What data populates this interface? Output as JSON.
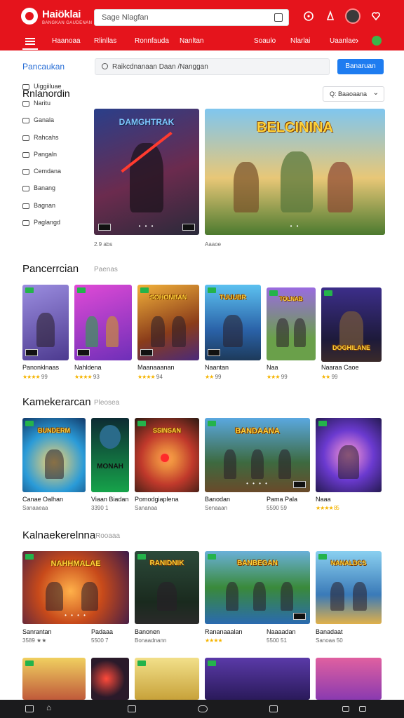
{
  "header": {
    "logo_title": "Haiöklai",
    "logo_sub": "BANGKAN GAUDENAN",
    "search_text": "Sage Nlagfan"
  },
  "nav": {
    "links": [
      "Haanoaa",
      "Rlinllas",
      "Ronnfauda",
      "Nanltan",
      "Soaulo",
      "Nlarlai",
      "Uaanlae"
    ]
  },
  "sidebar": {
    "title": "Pancaukan",
    "items": [
      "Uiggiiluae",
      "Naritu",
      "Ganala",
      "Rahcahs",
      "Pangaln",
      "Cemdana",
      "Banang",
      "Bagnan",
      "Paglangd"
    ]
  },
  "filter": {
    "search_placeholder": "Raikcdnanaan  Daan  /Nanggan",
    "search_button": "Banaruan",
    "sort_label": "Q: Baaoaana"
  },
  "featured": {
    "title": "Rnlanordin",
    "cards": [
      {
        "banner": "DAMGHTRAK",
        "label": "2.9 abs"
      },
      {
        "banner": "BELCININA",
        "label": "Aaaoe"
      }
    ]
  },
  "sections": [
    {
      "title": "Pancerrcian",
      "sub": "Paenas",
      "cards": [
        {
          "label": "Panonklnaas",
          "rating": "★★★★",
          "count": "99"
        },
        {
          "label": "Nahldena",
          "rating": "★★★★",
          "count": "93"
        },
        {
          "label": "Maanaaanan",
          "rating": "★★★★",
          "count": "94"
        },
        {
          "label": "Naantan",
          "rating": "★★",
          "count": "99"
        },
        {
          "label": "Naa",
          "rating": "★★★",
          "count": "99"
        },
        {
          "label": "Naaraa Caoe",
          "rating": "★★",
          "count": "99"
        }
      ],
      "banners": [
        "",
        "",
        "SOHONBAN",
        "TUUUBR",
        "TOLNAB",
        "DOGHILANE"
      ]
    },
    {
      "title": "Kamekerarcan",
      "sub": "Pleosea",
      "cards": [
        {
          "label": "Canae Oalhan",
          "meta": "Sanaaeaa"
        },
        {
          "label": "Viaan Biadan",
          "meta": "3390 1"
        },
        {
          "label": "Pomodgiaplena",
          "meta": "Sananaa"
        },
        {
          "label": "Banodan",
          "meta": "Senaaan"
        },
        {
          "label": "Pama Pala",
          "meta": "5590 59"
        },
        {
          "label": "Naaa",
          "meta": "★★★★ 85"
        }
      ],
      "banners": [
        "BUNDERM",
        "MONAH",
        "SSINSAN",
        "BANDAANA",
        "",
        ""
      ]
    },
    {
      "title": "Kalnaekerelnna",
      "sub": "Rooaaa",
      "cards": [
        {
          "label": "Sanrantan",
          "meta": "3589 ★★"
        },
        {
          "label": "Padaaa",
          "meta": "5500 7"
        },
        {
          "label": "Banonen",
          "meta": "Bonaadnann"
        },
        {
          "label": "Rananaaalan",
          "meta": "★★★★"
        },
        {
          "label": "Naaaadan",
          "meta": "5500 51"
        },
        {
          "label": "Banadaat",
          "meta": "Sanoaa 50"
        }
      ],
      "banners": [
        "NAHHMALAE",
        "RANIDNIK",
        "BANBEGAN",
        "",
        "",
        "NANALDCS"
      ]
    }
  ]
}
